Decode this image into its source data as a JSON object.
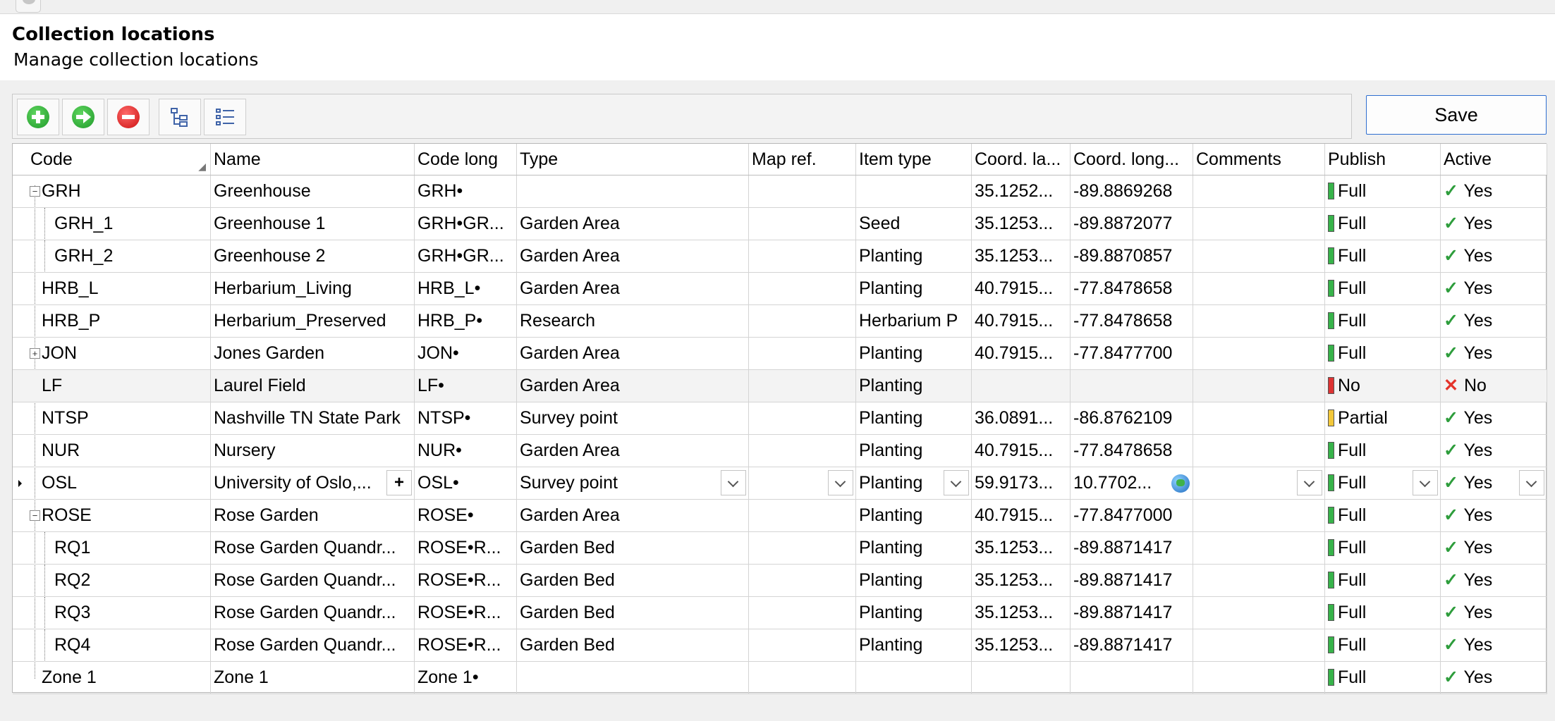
{
  "header": {
    "title": "Collection locations",
    "subtitle": "Manage collection locations"
  },
  "toolbar": {
    "buttons": [
      {
        "name": "add-icon"
      },
      {
        "name": "next-icon"
      },
      {
        "name": "remove-icon"
      },
      {
        "name": "tree-view-icon"
      },
      {
        "name": "list-view-icon"
      }
    ],
    "save_label": "Save"
  },
  "grid": {
    "columns": [
      "Code",
      "Name",
      "Code long",
      "Type",
      "Map ref.",
      "Item type",
      "Coord. la...",
      "Coord. long...",
      "Comments",
      "Publish",
      "Active"
    ],
    "rows": [
      {
        "code": "GRH",
        "name": "Greenhouse",
        "code_long": "GRH•",
        "type": "",
        "map_ref": "",
        "item_type": "",
        "lat": "35.1252...",
        "long": "-89.8869268",
        "comments": "",
        "publish": "Full",
        "active": "Yes"
      },
      {
        "code": "GRH_1",
        "name": "Greenhouse 1",
        "code_long": "GRH•GR...",
        "type": "Garden Area",
        "map_ref": "",
        "item_type": "Seed",
        "lat": "35.1253...",
        "long": "-89.8872077",
        "comments": "",
        "publish": "Full",
        "active": "Yes"
      },
      {
        "code": "GRH_2",
        "name": "Greenhouse 2",
        "code_long": "GRH•GR...",
        "type": "Garden Area",
        "map_ref": "",
        "item_type": "Planting",
        "lat": "35.1253...",
        "long": "-89.8870857",
        "comments": "",
        "publish": "Full",
        "active": "Yes"
      },
      {
        "code": "HRB_L",
        "name": "Herbarium_Living",
        "code_long": "HRB_L•",
        "type": "Garden Area",
        "map_ref": "",
        "item_type": "Planting",
        "lat": "40.7915...",
        "long": "-77.8478658",
        "comments": "",
        "publish": "Full",
        "active": "Yes"
      },
      {
        "code": "HRB_P",
        "name": "Herbarium_Preserved",
        "code_long": "HRB_P•",
        "type": "Research",
        "map_ref": "",
        "item_type": "Herbarium P",
        "lat": "40.7915...",
        "long": "-77.8478658",
        "comments": "",
        "publish": "Full",
        "active": "Yes"
      },
      {
        "code": "JON",
        "name": "Jones Garden",
        "code_long": "JON•",
        "type": "Garden Area",
        "map_ref": "",
        "item_type": "Planting",
        "lat": "40.7915...",
        "long": "-77.8477700",
        "comments": "",
        "publish": "Full",
        "active": "Yes"
      },
      {
        "code": "LF",
        "name": "Laurel Field",
        "code_long": "LF•",
        "type": "Garden Area",
        "map_ref": "",
        "item_type": "Planting",
        "lat": "",
        "long": "",
        "comments": "",
        "publish": "No",
        "active": "No"
      },
      {
        "code": "NTSP",
        "name": "Nashville TN State Park",
        "code_long": "NTSP•",
        "type": "Survey point",
        "map_ref": "",
        "item_type": "Planting",
        "lat": "36.0891...",
        "long": "-86.8762109",
        "comments": "",
        "publish": "Partial",
        "active": "Yes"
      },
      {
        "code": "NUR",
        "name": "Nursery",
        "code_long": "NUR•",
        "type": "Garden Area",
        "map_ref": "",
        "item_type": "Planting",
        "lat": "40.7915...",
        "long": "-77.8478658",
        "comments": "",
        "publish": "Full",
        "active": "Yes"
      },
      {
        "code": "OSL",
        "name": "University of Oslo,...",
        "code_long": "OSL•",
        "type": "Survey point",
        "map_ref": "",
        "item_type": "Planting",
        "lat": "59.9173...",
        "long": "10.7702...",
        "comments": "",
        "publish": "Full",
        "active": "Yes"
      },
      {
        "code": "ROSE",
        "name": "Rose Garden",
        "code_long": "ROSE•",
        "type": "Garden Area",
        "map_ref": "",
        "item_type": "Planting",
        "lat": "40.7915...",
        "long": "-77.8477000",
        "comments": "",
        "publish": "Full",
        "active": "Yes"
      },
      {
        "code": "RQ1",
        "name": "Rose Garden Quandr...",
        "code_long": "ROSE•R...",
        "type": "Garden Bed",
        "map_ref": "",
        "item_type": "Planting",
        "lat": "35.1253...",
        "long": "-89.8871417",
        "comments": "",
        "publish": "Full",
        "active": "Yes"
      },
      {
        "code": "RQ2",
        "name": "Rose Garden Quandr...",
        "code_long": "ROSE•R...",
        "type": "Garden Bed",
        "map_ref": "",
        "item_type": "Planting",
        "lat": "35.1253...",
        "long": "-89.8871417",
        "comments": "",
        "publish": "Full",
        "active": "Yes"
      },
      {
        "code": "RQ3",
        "name": "Rose Garden Quandr...",
        "code_long": "ROSE•R...",
        "type": "Garden Bed",
        "map_ref": "",
        "item_type": "Planting",
        "lat": "35.1253...",
        "long": "-89.8871417",
        "comments": "",
        "publish": "Full",
        "active": "Yes"
      },
      {
        "code": "RQ4",
        "name": "Rose Garden Quandr...",
        "code_long": "ROSE•R...",
        "type": "Garden Bed",
        "map_ref": "",
        "item_type": "Planting",
        "lat": "35.1253...",
        "long": "-89.8871417",
        "comments": "",
        "publish": "Full",
        "active": "Yes"
      },
      {
        "code": "Zone 1",
        "name": "Zone 1",
        "code_long": "Zone 1•",
        "type": "",
        "map_ref": "",
        "item_type": "",
        "lat": "",
        "long": "",
        "comments": "",
        "publish": "Full",
        "active": "Yes"
      }
    ]
  },
  "colors": {
    "publish_full": "#37b34a",
    "publish_no": "#dd3333",
    "publish_partial": "#f3c83a",
    "active_yes": "#2e9d3c",
    "active_no": "#e4332a",
    "save_border": "#2f6fd0"
  }
}
